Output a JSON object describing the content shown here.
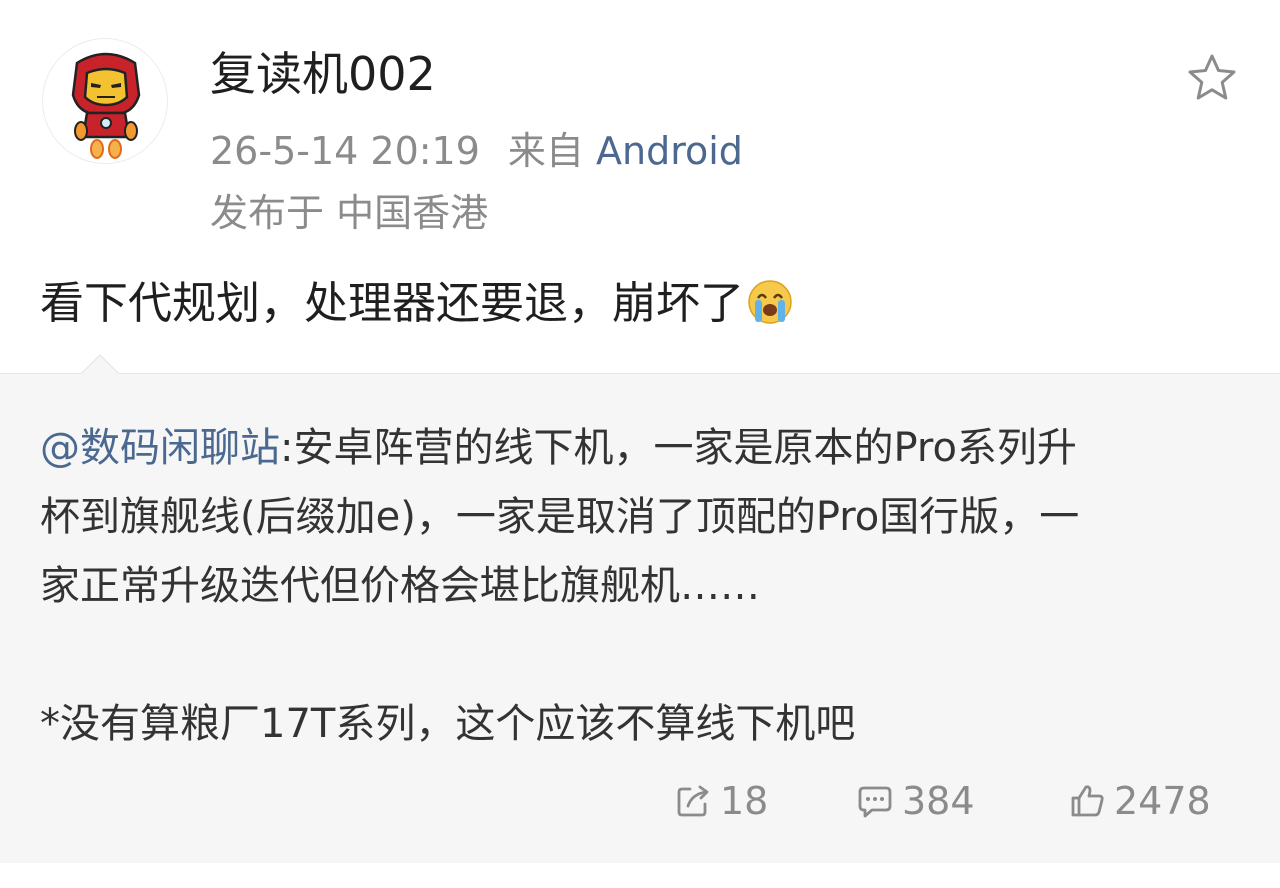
{
  "post": {
    "author": {
      "name": "复读机002",
      "avatar_icon": "iron-man-avatar-icon"
    },
    "meta": {
      "time": "26-5-14 20:19",
      "source_prefix": "来自",
      "source_app": "Android"
    },
    "location": "发布于 中国香港",
    "text": "看下代规划，处理器还要退，崩坏了",
    "text_emoji": "crying-face-icon",
    "favorite_icon": "star-outline-icon"
  },
  "repost": {
    "mention": "@数码闲聊站",
    "body_line1": ":安卓阵营的线下机，一家是原本的Pro系列升",
    "body_line2": "杯到旗舰线(后缀加e)，一家是取消了顶配的Pro国行版，一",
    "body_line3": "家正常升级迭代但价格会堪比旗舰机……",
    "footnote": "*没有算粮厂17T系列，这个应该不算线下机吧",
    "actions": {
      "reposts": "18",
      "comments": "384",
      "likes": "2478"
    }
  },
  "colors": {
    "link": "#4a6890",
    "muted": "#8b8b8b",
    "repost_bg": "#f6f6f6"
  }
}
